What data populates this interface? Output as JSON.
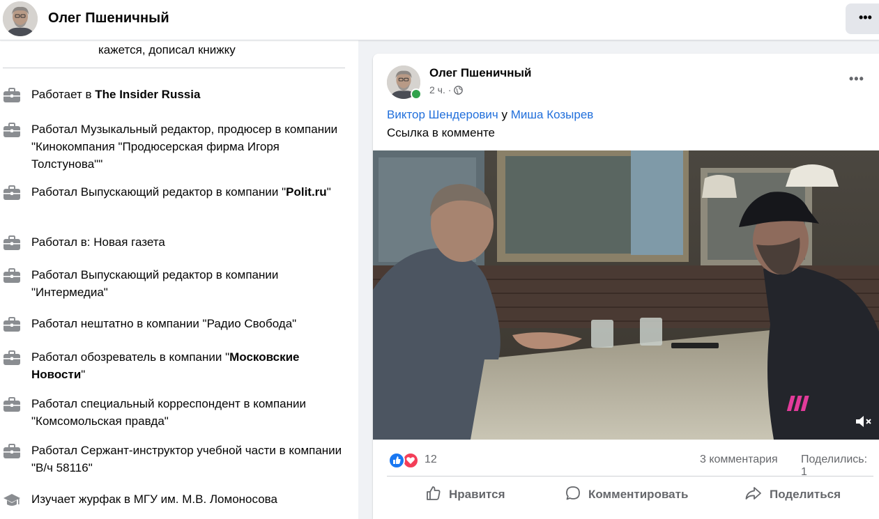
{
  "profile": {
    "name": "Олег Пшеничный"
  },
  "header": {
    "more_label": "•••"
  },
  "intro": {
    "cutoff_text": "кажется, дописал книжку",
    "work": [
      {
        "prefix": "Работает в ",
        "bold": "The Insider Russia",
        "suffix": "",
        "icon": "briefcase-icon"
      },
      {
        "prefix": "Работал Музыкальный редактор, продюсер в компании \"Кинокомпания \"Продюсерская фирма Игоря Толстунова\"\"",
        "bold": "",
        "suffix": "",
        "icon": "briefcase-icon"
      },
      {
        "prefix": "Работал Выпускающий редактор в компании \"",
        "bold": "Polit.ru",
        "suffix": "\"",
        "icon": "briefcase-icon"
      },
      {
        "prefix": "Работал в: Новая газета",
        "bold": "",
        "suffix": "",
        "icon": "briefcase-icon"
      },
      {
        "prefix": "Работал Выпускающий редактор в компании \"Интермедиа\"",
        "bold": "",
        "suffix": "",
        "icon": "briefcase-icon"
      },
      {
        "prefix": "Работал нештатно в компании \"Радио Свобода\"",
        "bold": "",
        "suffix": "",
        "icon": "briefcase-icon"
      },
      {
        "prefix": "Работал обозреватель в компании \"",
        "bold": "Московские Новости",
        "suffix": "\"",
        "icon": "briefcase-icon"
      },
      {
        "prefix": "Работал специальный корреспондент в компании \"Комсомольская правда\"",
        "bold": "",
        "suffix": "",
        "icon": "briefcase-icon"
      },
      {
        "prefix": "Работал Сержант-инструктор учебной части в компании \"В/ч 58116\"",
        "bold": "",
        "suffix": "",
        "icon": "briefcase-icon"
      },
      {
        "prefix": "Изучает журфак в МГУ им. М.В. Ломоносова",
        "bold": "",
        "suffix": "",
        "icon": "graduation-cap-icon"
      }
    ]
  },
  "post": {
    "author": "Олег Пшеничный",
    "time": "2 ч.",
    "privacy_separator": "·",
    "privacy_icon": "globe-icon",
    "more_label": "•••",
    "tagged_person": "Виктор Шендерович",
    "location_word": " у ",
    "location_person": "Миша Козырев",
    "text": "Ссылка в комменте",
    "video_logo": "///",
    "video_muted_icon": "speaker-muted-icon",
    "reactions_count": "12",
    "comments_count": "3 комментария",
    "shares_count": "Поделились: 1",
    "actions": {
      "like": "Нравится",
      "comment": "Комментировать",
      "share": "Поделиться"
    },
    "colors": {
      "like": "#1877f2",
      "love": "#f33e58",
      "link": "#216fdb",
      "online": "#31a24c"
    }
  }
}
